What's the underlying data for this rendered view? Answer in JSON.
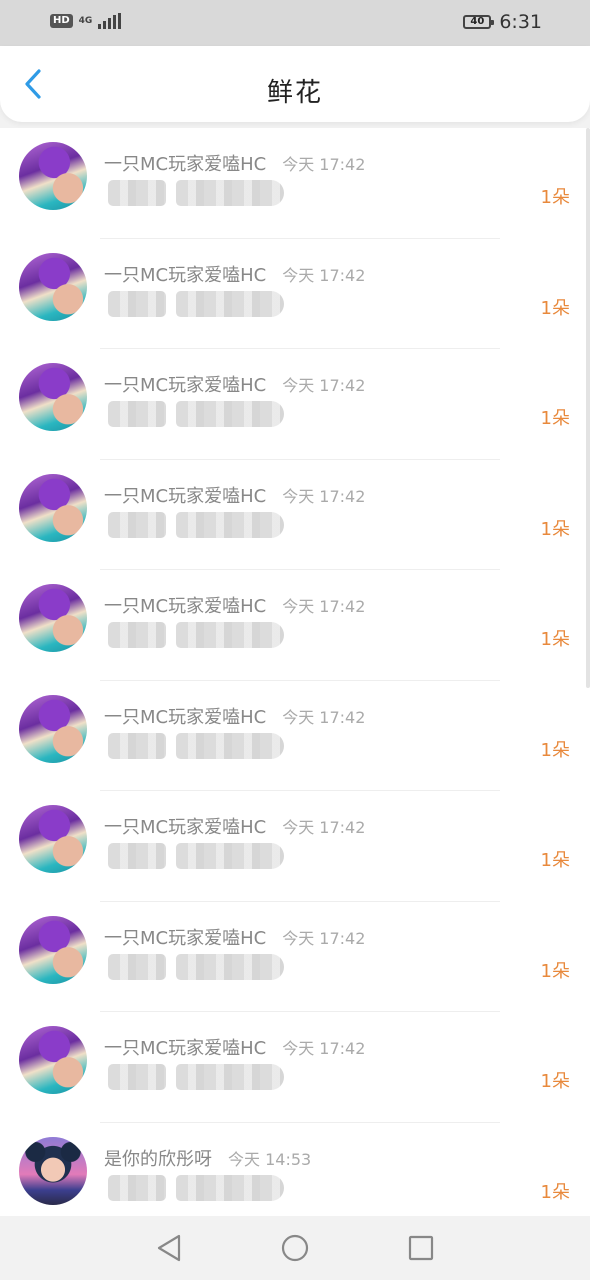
{
  "status_bar": {
    "hd": "HD",
    "network": "4G",
    "battery": "40",
    "time": "6:31"
  },
  "header": {
    "title": "鲜花",
    "back_icon": "chevron-left-icon",
    "accent_color": "#2f9be6"
  },
  "flowers": [
    {
      "name": "一只MC玩家爱嗑HC",
      "time": "今天 17:42",
      "count": "1朵",
      "avatar": "mc"
    },
    {
      "name": "一只MC玩家爱嗑HC",
      "time": "今天 17:42",
      "count": "1朵",
      "avatar": "mc"
    },
    {
      "name": "一只MC玩家爱嗑HC",
      "time": "今天 17:42",
      "count": "1朵",
      "avatar": "mc"
    },
    {
      "name": "一只MC玩家爱嗑HC",
      "time": "今天 17:42",
      "count": "1朵",
      "avatar": "mc"
    },
    {
      "name": "一只MC玩家爱嗑HC",
      "time": "今天 17:42",
      "count": "1朵",
      "avatar": "mc"
    },
    {
      "name": "一只MC玩家爱嗑HC",
      "time": "今天 17:42",
      "count": "1朵",
      "avatar": "mc"
    },
    {
      "name": "一只MC玩家爱嗑HC",
      "time": "今天 17:42",
      "count": "1朵",
      "avatar": "mc"
    },
    {
      "name": "一只MC玩家爱嗑HC",
      "time": "今天 17:42",
      "count": "1朵",
      "avatar": "mc"
    },
    {
      "name": "一只MC玩家爱嗑HC",
      "time": "今天 17:42",
      "count": "1朵",
      "avatar": "mc"
    },
    {
      "name": "是你的欣彤呀",
      "time": "今天 14:53",
      "count": "1朵",
      "avatar": "girl"
    }
  ],
  "count_color": "#e8893c",
  "nav": {
    "back": "triangle-back-icon",
    "home": "circle-home-icon",
    "recents": "square-recents-icon"
  }
}
